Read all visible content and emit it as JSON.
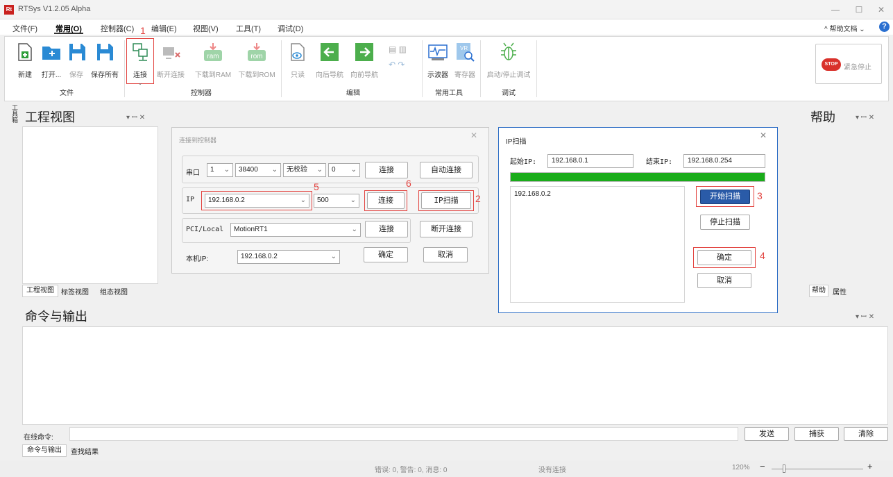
{
  "app": {
    "title": "RTSys V1.2.05 Alpha",
    "logo": "Rt"
  },
  "menu": {
    "items": [
      "文件(F)",
      "常用(O)",
      "控制器(C)",
      "编辑(E)",
      "视图(V)",
      "工具(T)",
      "调试(D)"
    ],
    "help": "帮助文档"
  },
  "ribbon": {
    "file": {
      "new": "新建",
      "open": "打开...",
      "save": "保存",
      "save_all": "保存所有",
      "group": "文件"
    },
    "controller": {
      "connect": "连接",
      "disconnect": "断开连接",
      "download_ram": "下载到RAM",
      "download_rom": "下载到ROM",
      "group": "控制器",
      "ram": "ram",
      "rom": "rom"
    },
    "edit": {
      "readonly": "只读",
      "back": "向后导航",
      "forward": "向前导航",
      "group": "编辑"
    },
    "tools": {
      "oscilloscope": "示波器",
      "register": "寄存器",
      "group": "常用工具",
      "vr": "VR"
    },
    "debug": {
      "start_stop": "启动/停止调试",
      "group": "调试"
    },
    "estop": {
      "label": "紧急停止",
      "badge": "STOP"
    }
  },
  "annotations": {
    "n1": "1",
    "n2": "2",
    "n3": "3",
    "n4": "4",
    "n5": "5",
    "n6": "6"
  },
  "left_panel": {
    "title": "工程视图",
    "side_tab": "工具箱",
    "tabs": [
      "工程视图",
      "标签视图",
      "组态视图"
    ]
  },
  "right_panel": {
    "title": "帮助",
    "tabs": [
      "帮助",
      "属性"
    ]
  },
  "connect_dialog": {
    "title": "连接到控制器",
    "serial": {
      "label": "串口",
      "port": "1",
      "baud": "38400",
      "parity": "无校验",
      "stop": "0",
      "connect": "连接",
      "auto": "自动连接"
    },
    "ip": {
      "label": "IP",
      "address": "192.168.0.2",
      "timeout": "500",
      "connect": "连接",
      "scan": "IP扫描"
    },
    "pci": {
      "label": "PCI/Local",
      "device": "MotionRT1",
      "connect": "连接",
      "disconnect": "断开连接"
    },
    "local": {
      "label": "本机IP:",
      "address": "192.168.0.2",
      "ok": "确定",
      "cancel": "取消"
    }
  },
  "scan_dialog": {
    "title": "IP扫描",
    "start_label": "起始IP:",
    "start_ip": "192.168.0.1",
    "end_label": "结束IP:",
    "end_ip": "192.168.0.254",
    "progress": 1.0,
    "results": [
      "192.168.0.2"
    ],
    "start_btn": "开始扫描",
    "stop_btn": "停止扫描",
    "ok": "确定",
    "cancel": "取消"
  },
  "output": {
    "title": "命令与输出",
    "cmd_label": "在线命令:",
    "send": "发送",
    "capture": "捕获",
    "clear": "清除",
    "tabs": [
      "命令与输出",
      "查找结果"
    ]
  },
  "status": {
    "messages": "错误: 0, 警告: 0, 消息: 0",
    "connection": "没有连接",
    "zoom": "120%"
  },
  "colors": {
    "accent": "#2a5ba8",
    "annotation": "#e2433f",
    "progress": "#1aac1a"
  }
}
